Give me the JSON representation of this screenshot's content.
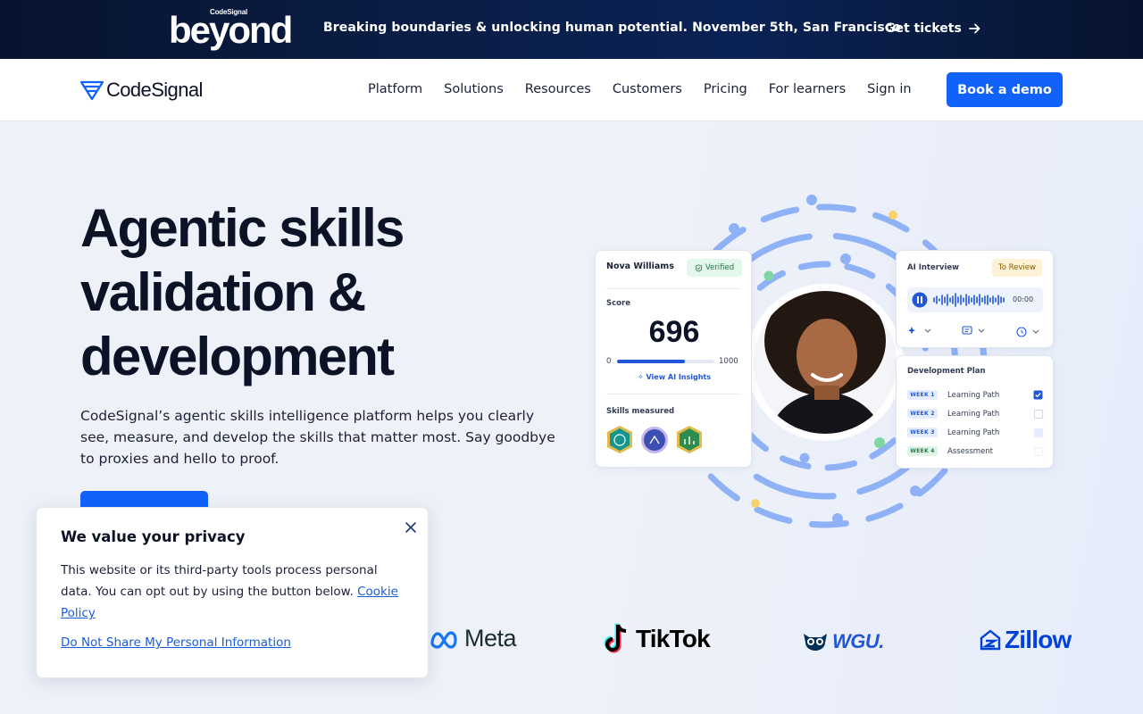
{
  "banner": {
    "logo_small": "CodeSignal",
    "logo_big": "beyond",
    "text": "Breaking boundaries & unlocking human potential. November 5th, San Francisco",
    "cta": "Get tickets"
  },
  "nav": {
    "brand": "CodeSignal",
    "links": [
      "Platform",
      "Solutions",
      "Resources",
      "Customers",
      "Pricing",
      "For learners",
      "Sign in"
    ],
    "cta": "Book a demo"
  },
  "hero": {
    "title": "Agentic skills validation & development",
    "subtitle": "CodeSignal’s agentic skills intelligence platform helps you clearly see, measure, and develop the skills that matter most. Say goodbye to proxies and hello to proof."
  },
  "profile_card": {
    "name": "Nova Williams",
    "badge": "Verified",
    "score_label": "Score",
    "score": "696",
    "range_min": "0",
    "range_max": "1000",
    "score_fraction": 0.696,
    "insights_link": "View AI Insights",
    "skills_label": "Skills measured"
  },
  "ai_card": {
    "title": "AI Interview",
    "badge": "To Review",
    "time": "00:00"
  },
  "dev_card": {
    "title": "Development Plan",
    "rows": [
      {
        "week": "WEEK 1",
        "label": "Learning Path",
        "checked": true
      },
      {
        "week": "WEEK 2",
        "label": "Learning Path",
        "checked": false
      },
      {
        "week": "WEEK 3",
        "label": "Learning Path",
        "checked": false
      },
      {
        "week": "WEEK 4",
        "label": "Assessment",
        "checked": false
      }
    ]
  },
  "logos": [
    "Meta",
    "TikTok",
    "WGU.",
    "Zillow"
  ],
  "privacy": {
    "title": "We value your privacy",
    "body": "This website or its third-party tools process personal data. You can opt out by using the button below.",
    "policy_link": "Cookie Policy",
    "opt_out_link": "Do Not Share My Personal Information"
  },
  "colors": {
    "brand_blue": "#1062fb",
    "banner_bg": "#0b1d45",
    "hero_bg": "#eef1f8"
  }
}
